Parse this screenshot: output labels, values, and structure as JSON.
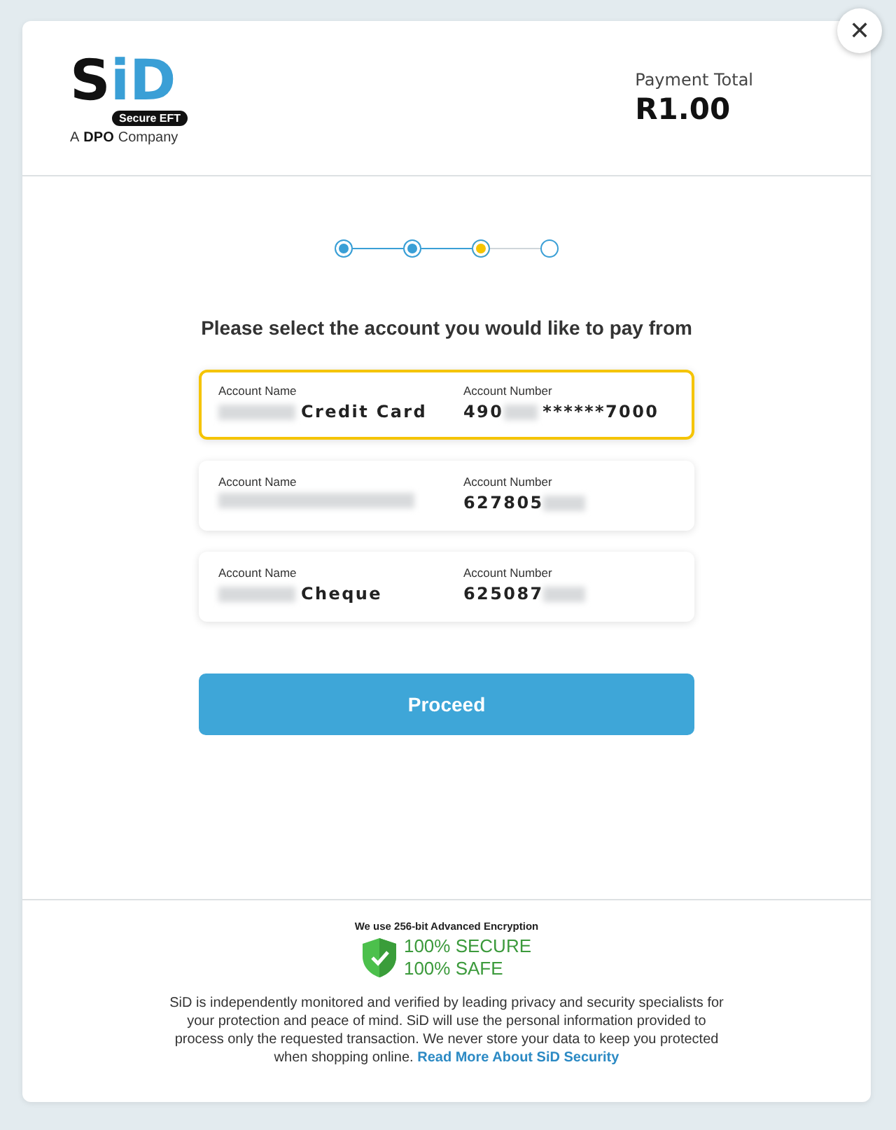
{
  "logo": {
    "letters": [
      "S",
      "i",
      "D"
    ],
    "badge": "Secure EFT",
    "tagline_before": "A",
    "tagline_brand": "DPO",
    "tagline_after": "Company"
  },
  "payment": {
    "label": "Payment Total",
    "amount": "R1.00"
  },
  "close": {
    "symbol": "✕"
  },
  "steps": [
    {
      "done": true,
      "current": false
    },
    {
      "done": true,
      "current": false
    },
    {
      "done": false,
      "current": true
    },
    {
      "done": false,
      "current": false
    }
  ],
  "prompt": "Please select the account you would like to pay from",
  "accounts": [
    {
      "name_label": "Account Name",
      "name_visible": "Credit Card",
      "name_blurred": true,
      "number_label": "Account Number",
      "number_start": "490",
      "number_end": "******7000",
      "selected": true
    },
    {
      "name_label": "Account Name",
      "name_blurred": true,
      "number_label": "Account Number",
      "number_start": "627805",
      "selected": false
    },
    {
      "name_label": "Account Name",
      "name_visible": "Cheque",
      "name_blurred": true,
      "number_label": "Account Number",
      "number_start": "625087",
      "selected": false
    }
  ],
  "proceed": "Proceed",
  "security": {
    "encryption": "We use 256-bit Advanced Encryption",
    "lines": [
      "100% SECURE",
      "100% SAFE"
    ]
  },
  "disclaimer": "SiD is independently monitored and verified by leading privacy and security specialists for your protection and peace of mind. SiD will use the personal information provided to process only the requested transaction. We never store your data to keep you protected when shopping online.",
  "disclaimer_link": "Read More About SiD Security"
}
